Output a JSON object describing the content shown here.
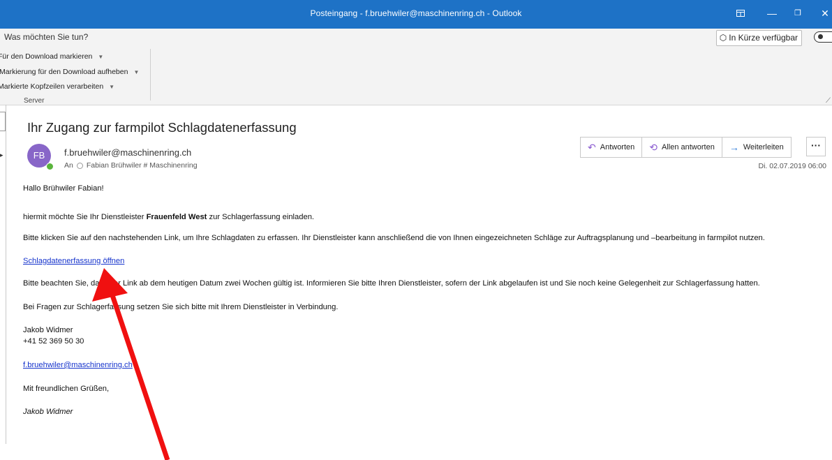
{
  "window": {
    "title": "Posteingang - f.bruehwiler@maschinenring.ch  -  Outlook",
    "controls": {
      "minimize": "—",
      "restore": "❐",
      "close": "✕"
    }
  },
  "ribbon": {
    "tellme_placeholder": "Was möchten Sie tun?",
    "coming_soon": "In Kürze verfügbar",
    "items": [
      "Für den Download markieren",
      "Markierung für den Download aufheben",
      "Markierte Kopfzeilen verarbeiten"
    ],
    "group_label": "Server"
  },
  "message": {
    "subject": "Ihr Zugang zur farmpilot Schlagdatenerfassung",
    "avatar_initials": "FB",
    "sender": "f.bruehwiler@maschinenring.ch",
    "to_label": "An",
    "to_value": "Fabian Brühwiler # Maschinenring",
    "date": "Di. 02.07.2019 06:00",
    "actions": {
      "reply": "Antworten",
      "reply_all": "Allen antworten",
      "forward": "Weiterleiten",
      "more": "···"
    }
  },
  "body": {
    "greeting": "Hallo Brühwiler Fabian!",
    "intro_before": "hiermit möchte Sie Ihr Dienstleister ",
    "intro_bold": "Frauenfeld West",
    "intro_after": " zur Schlagerfassung einladen.",
    "instructions": "Bitte klicken Sie auf den nachstehenden Link, um Ihre Schlagdaten zu erfassen. Ihr Dienstleister kann anschließend die von Ihnen eingezeichneten Schläge zur Auftragsplanung und –bearbeitung in farmpilot nutzen.",
    "link": "Schlagdatenerfassung öffnen",
    "validity": "Bitte beachten Sie, dass der Link ab dem heutigen Datum zwei Wochen gültig ist. Informieren Sie bitte Ihren Dienstleister, sofern der Link abgelaufen ist und Sie noch keine Gelegenheit zur Schlagerfassung hatten.",
    "questions": "Bei Fragen zur Schlagerfassung setzen Sie sich bitte mit Ihrem Dienstleister in Verbindung.",
    "sig_name": "Jakob Widmer",
    "sig_phone": "+41 52 369 50 30",
    "sig_email": "f.bruehwiler@maschinenring.ch",
    "closing": "Mit freundlichen Grüßen,",
    "sig_italic": "Jakob Widmer"
  },
  "colors": {
    "titlebar": "#1e72c6",
    "annotation_arrow": "#f01010",
    "link": "#1533cc",
    "avatar": "#8866c8"
  }
}
